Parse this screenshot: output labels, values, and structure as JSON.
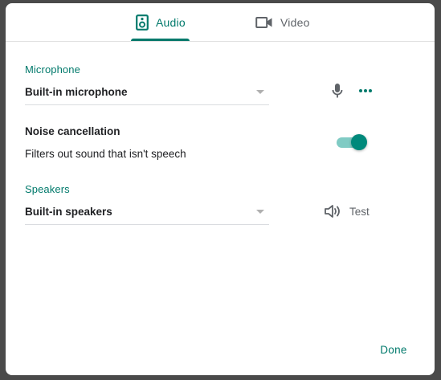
{
  "tabs": [
    {
      "label": "Audio",
      "icon": "speaker-icon",
      "selected": true
    },
    {
      "label": "Video",
      "icon": "camera-icon",
      "selected": false
    }
  ],
  "microphone": {
    "label": "Microphone",
    "selected_value": "Built-in microphone",
    "icon": "mic-icon",
    "more_icon": "more-horizontal-icon"
  },
  "noise_cancellation": {
    "title": "Noise cancellation",
    "description": "Filters out sound that isn't speech",
    "enabled": true
  },
  "speakers": {
    "label": "Speakers",
    "selected_value": "Built-in speakers",
    "test_label": "Test",
    "test_icon": "volume-icon"
  },
  "footer": {
    "done_label": "Done"
  },
  "colors": {
    "accent": "#00796b",
    "toggle_thumb": "#00897b",
    "toggle_track": "#80cbc4",
    "text": "#202124",
    "secondary_text": "#5f6368"
  }
}
